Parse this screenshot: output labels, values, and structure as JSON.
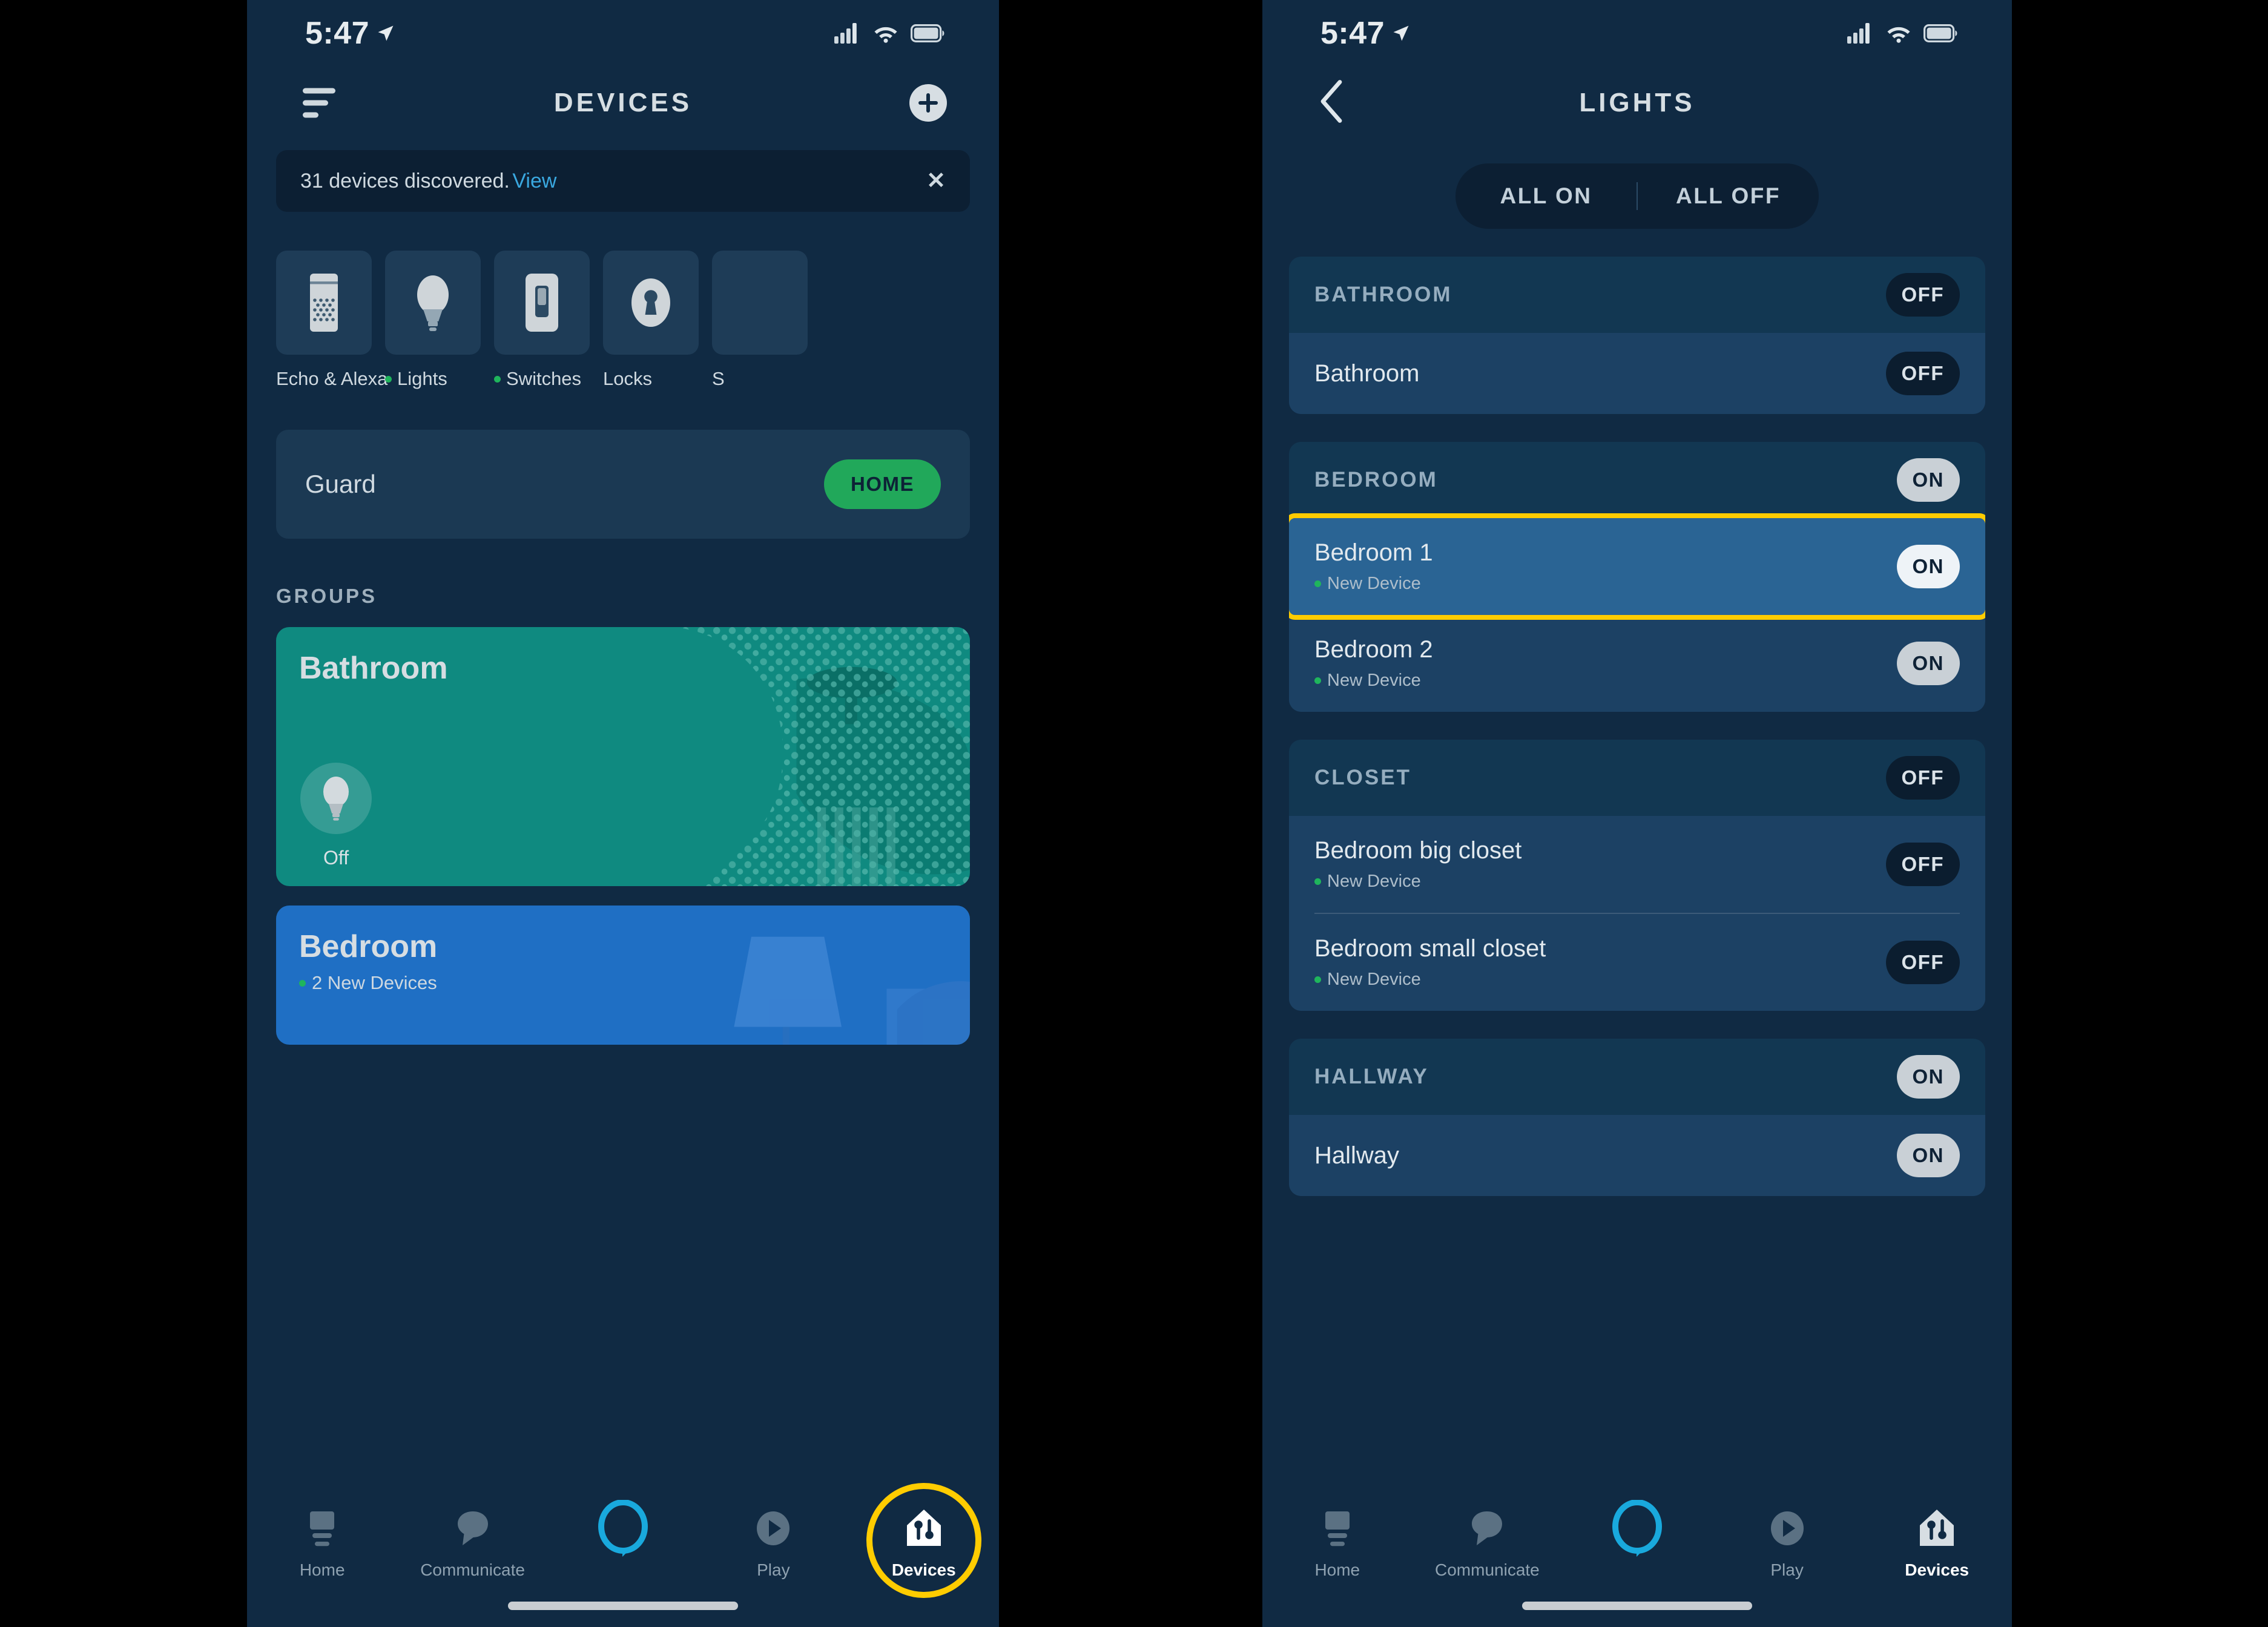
{
  "left_screen": {
    "status": {
      "time": "5:47",
      "location_icon": "location-arrow-icon",
      "cellular_icon": "cellular-bars-icon",
      "wifi_icon": "wifi-icon",
      "battery_icon": "battery-icon"
    },
    "header": {
      "title": "DEVICES",
      "menu_icon": "hamburger-menu-icon",
      "add_icon": "plus-icon"
    },
    "banner": {
      "message": "31 devices discovered.",
      "link": "View",
      "close_icon": "close-icon"
    },
    "categories": [
      {
        "label": "Echo & Alexa",
        "icon": "echo-speaker-icon",
        "has_new_dot": false
      },
      {
        "label": "Lights",
        "icon": "lightbulb-icon",
        "has_new_dot": true
      },
      {
        "label": "Switches",
        "icon": "light-switch-icon",
        "has_new_dot": true
      },
      {
        "label": "Locks",
        "icon": "lock-keyhole-icon",
        "has_new_dot": false
      },
      {
        "label": "S",
        "icon": "speaker-icon",
        "has_new_dot": false
      }
    ],
    "guard": {
      "label": "Guard",
      "state": "HOME",
      "state_color": "#21a85a"
    },
    "groups_heading": "GROUPS",
    "groups": [
      {
        "title": "Bathroom",
        "subtitle": "",
        "state": "Off",
        "color": "#0f8a80",
        "illustration": "shower-illustration",
        "has_new_dot": false
      },
      {
        "title": "Bedroom",
        "subtitle": "2 New Devices",
        "state": "",
        "color": "#1f6fc4",
        "illustration": "bedroom-illustration",
        "has_new_dot": true
      }
    ],
    "tabs": [
      {
        "label": "Home",
        "icon": "home-icon",
        "active": false,
        "highlighted": false
      },
      {
        "label": "Communicate",
        "icon": "speech-bubble-icon",
        "active": false,
        "highlighted": false
      },
      {
        "label": "",
        "icon": "alexa-ring-icon",
        "active": false,
        "highlighted": false
      },
      {
        "label": "Play",
        "icon": "play-circle-icon",
        "active": false,
        "highlighted": false
      },
      {
        "label": "Devices",
        "icon": "devices-house-icon",
        "active": true,
        "highlighted": true
      }
    ]
  },
  "right_screen": {
    "status": {
      "time": "5:47",
      "location_icon": "location-arrow-icon",
      "cellular_icon": "cellular-bars-icon",
      "wifi_icon": "wifi-icon",
      "battery_icon": "battery-icon"
    },
    "header": {
      "title": "LIGHTS",
      "back_icon": "chevron-left-icon"
    },
    "all_controls": {
      "all_on": "ALL ON",
      "all_off": "ALL OFF"
    },
    "groups": [
      {
        "name": "BATHROOM",
        "state": "OFF",
        "rows": [
          {
            "title": "Bathroom",
            "subtitle": "",
            "state": "OFF",
            "highlighted": false
          }
        ]
      },
      {
        "name": "BEDROOM",
        "state": "ON",
        "rows": [
          {
            "title": "Bedroom 1",
            "subtitle": "New Device",
            "state": "ON",
            "highlighted": true
          },
          {
            "title": "Bedroom 2",
            "subtitle": "New Device",
            "state": "ON",
            "highlighted": false
          }
        ]
      },
      {
        "name": "CLOSET",
        "state": "OFF",
        "rows": [
          {
            "title": "Bedroom big closet",
            "subtitle": "New Device",
            "state": "OFF",
            "highlighted": false
          },
          {
            "title": "Bedroom small closet",
            "subtitle": "New Device",
            "state": "OFF",
            "highlighted": false
          }
        ]
      },
      {
        "name": "HALLWAY",
        "state": "ON",
        "rows": [
          {
            "title": "Hallway",
            "subtitle": "",
            "state": "ON",
            "highlighted": false
          }
        ]
      }
    ],
    "tabs": [
      {
        "label": "Home",
        "icon": "home-icon",
        "active": false
      },
      {
        "label": "Communicate",
        "icon": "speech-bubble-icon",
        "active": false
      },
      {
        "label": "",
        "icon": "alexa-ring-icon",
        "active": false
      },
      {
        "label": "Play",
        "icon": "play-circle-icon",
        "active": false
      },
      {
        "label": "Devices",
        "icon": "devices-house-icon",
        "active": true
      }
    ]
  },
  "colors": {
    "app_background": "#102a43",
    "card": "#1b3953",
    "banner": "#0c1f33",
    "accent_link": "#3aa8e0",
    "accent_green": "#1fb55c",
    "guard_home": "#21a85a",
    "bathroom_group": "#0f8a80",
    "bedroom_group": "#1f6fc4",
    "highlight_yellow": "#ffcc00",
    "alexa_blue": "#19a9dd"
  }
}
